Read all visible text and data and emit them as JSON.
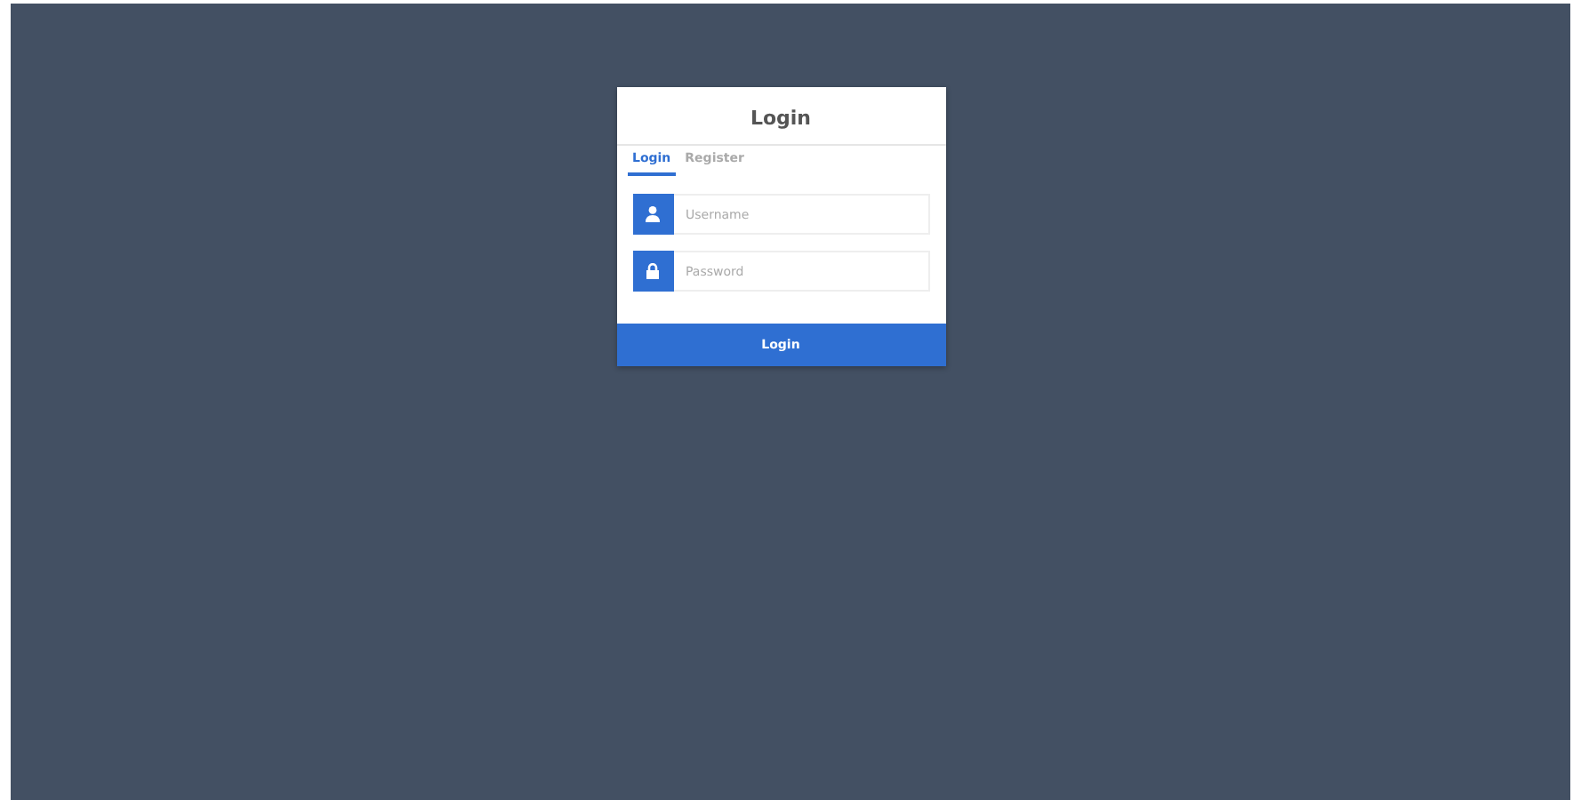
{
  "card": {
    "title": "Login"
  },
  "tabs": [
    {
      "label": "Login",
      "selected": true
    },
    {
      "label": "Register",
      "selected": false
    }
  ],
  "fields": [
    {
      "kind": "user",
      "placeholder": "Username"
    },
    {
      "kind": "lock",
      "placeholder": "Password"
    }
  ],
  "submit": {
    "label": "Login"
  }
}
